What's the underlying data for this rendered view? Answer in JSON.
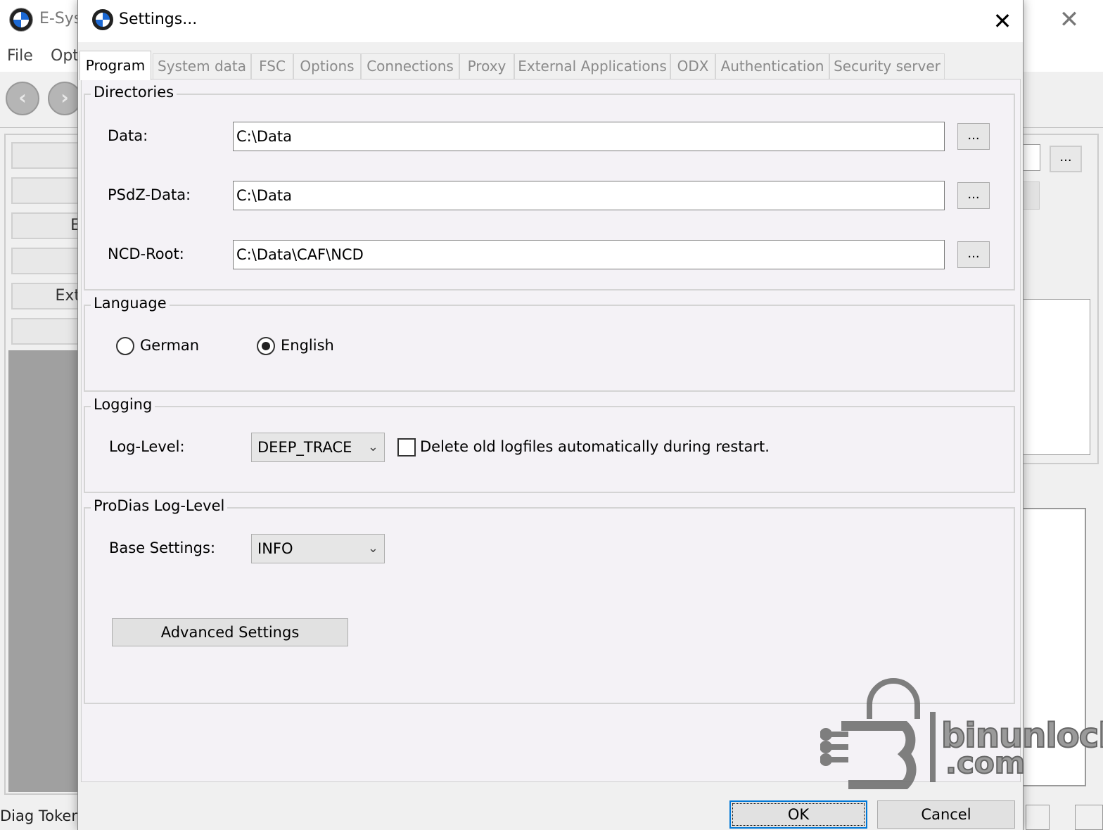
{
  "background_window": {
    "title": "E-Sys",
    "close_glyph": "✕",
    "menu": [
      "File",
      "Opt"
    ],
    "side_buttons": [
      "",
      "",
      "E",
      "",
      "Ext",
      ""
    ],
    "status_label": "Diag Token:",
    "browse_label": "..."
  },
  "dialog": {
    "title": "Settings...",
    "close_glyph": "✕",
    "tabs": [
      {
        "label": "Program",
        "active": true
      },
      {
        "label": "System data",
        "active": false
      },
      {
        "label": "FSC",
        "active": false
      },
      {
        "label": "Options",
        "active": false
      },
      {
        "label": "Connections",
        "active": false
      },
      {
        "label": "Proxy",
        "active": false
      },
      {
        "label": "External Applications",
        "active": false
      },
      {
        "label": "ODX",
        "active": false
      },
      {
        "label": "Authentication",
        "active": false
      },
      {
        "label": "Security server",
        "active": false
      }
    ],
    "directories": {
      "group_label": "Directories",
      "browse_label": "...",
      "fields": [
        {
          "label": "Data:",
          "value": "C:\\Data"
        },
        {
          "label": "PSdZ-Data:",
          "value": "C:\\Data"
        },
        {
          "label": "NCD-Root:",
          "value": "C:\\Data\\CAF\\NCD"
        }
      ]
    },
    "language": {
      "group_label": "Language",
      "options": [
        {
          "label": "German",
          "selected": false
        },
        {
          "label": "English",
          "selected": true
        }
      ]
    },
    "logging": {
      "group_label": "Logging",
      "log_level_label": "Log-Level:",
      "log_level_value": "DEEP_TRACE",
      "delete_old_label": "Delete old logfiles automatically during restart.",
      "delete_old_checked": false
    },
    "prodias": {
      "group_label": "ProDias Log-Level",
      "base_settings_label": "Base Settings:",
      "base_settings_value": "INFO",
      "advanced_button": "Advanced Settings"
    },
    "buttons": {
      "ok": "OK",
      "cancel": "Cancel"
    }
  },
  "watermark": {
    "line1": "binunlock",
    "line2": ".com"
  },
  "colors": {
    "window_bg": "#f0f0f0",
    "tab_page_bg": "#f4f2f6",
    "inactive_tab_text": "#8a8a8a",
    "focus_outline": "#0078d7"
  }
}
